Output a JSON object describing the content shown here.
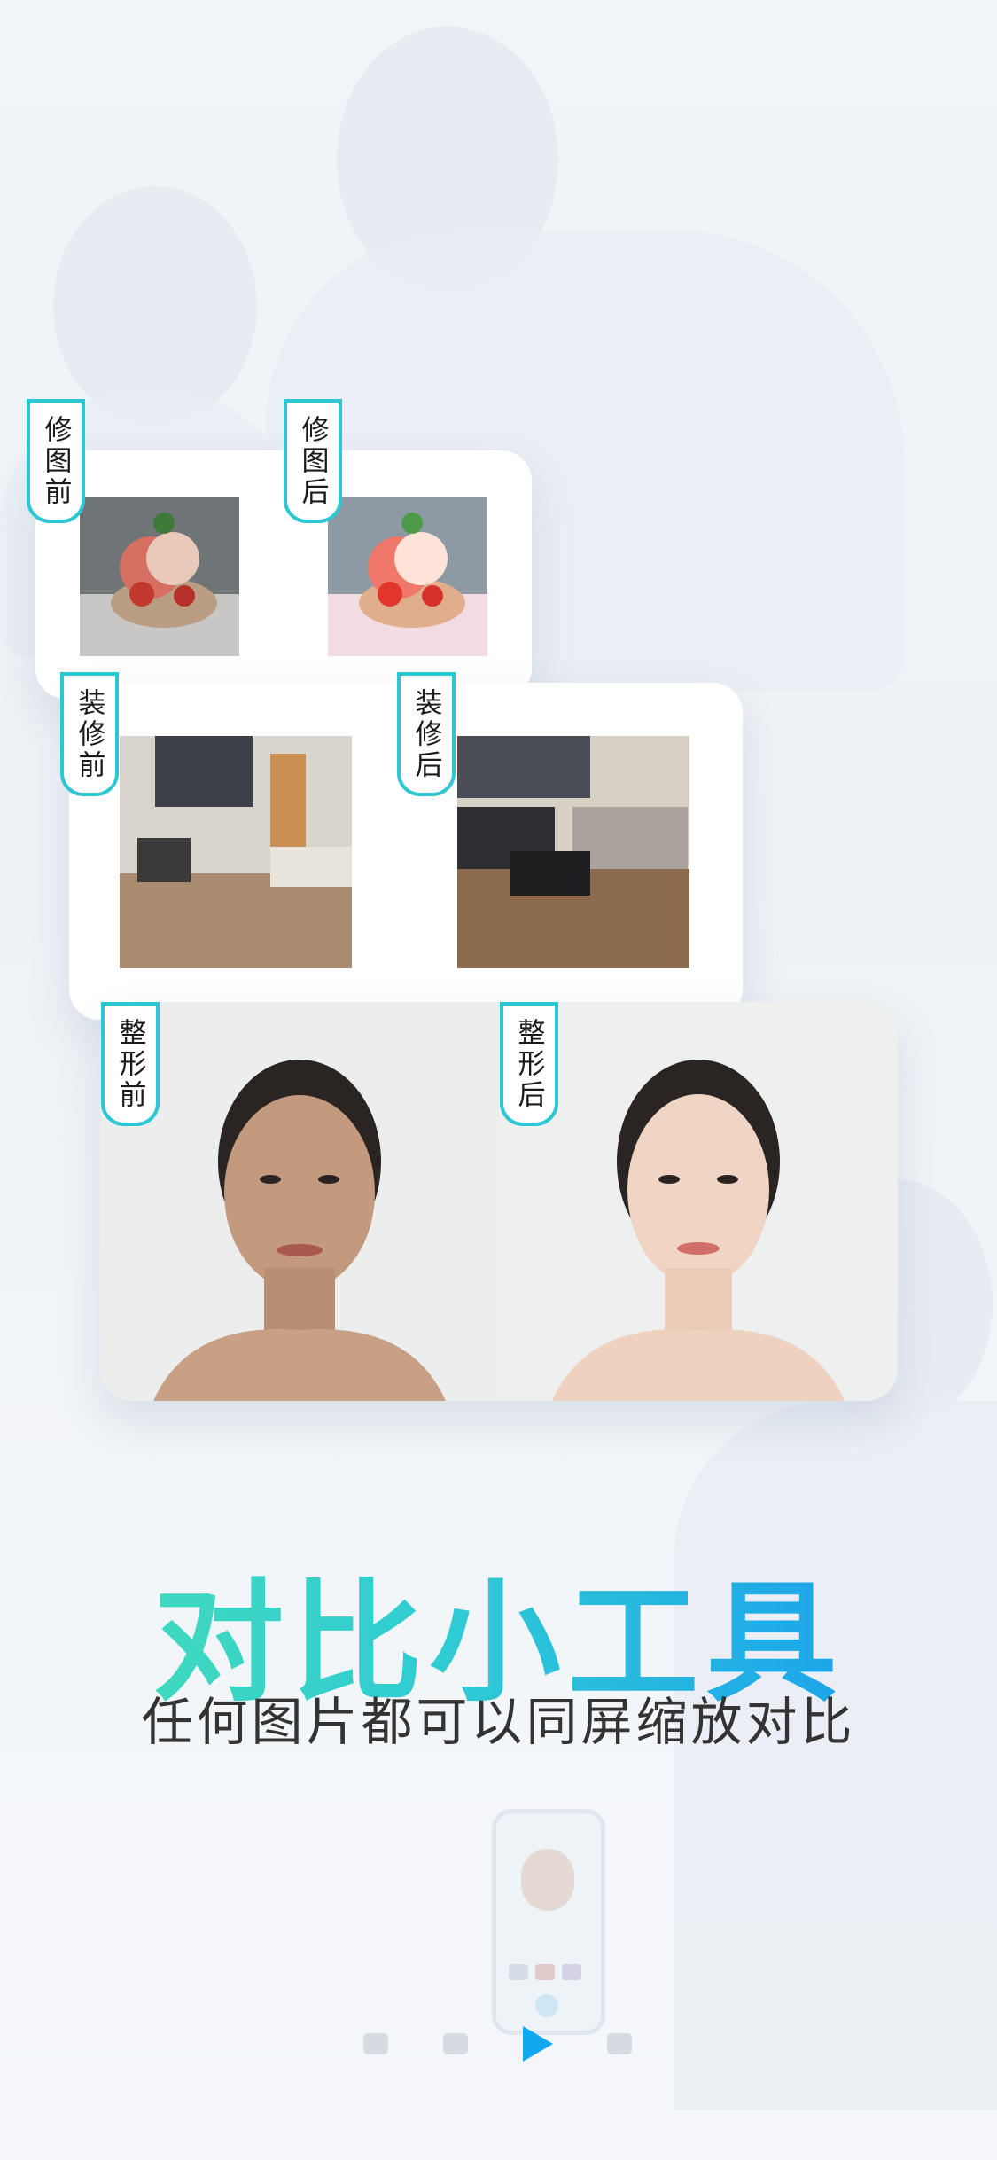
{
  "cards": [
    {
      "before_label": "修图前",
      "after_label": "修图后"
    },
    {
      "before_label": "装修前",
      "after_label": "装修后"
    },
    {
      "before_label": "整形前",
      "after_label": "整形后"
    }
  ],
  "headline": "对比小工具",
  "subline": "任何图片都可以同屏缩放对比",
  "pager": {
    "count": 4,
    "active_index": 2,
    "active_icon": "play-triangle-icon"
  },
  "colors": {
    "accent_start": "#48e0b4",
    "accent_end": "#1596f3",
    "tag_border": "#2dc6d3"
  }
}
